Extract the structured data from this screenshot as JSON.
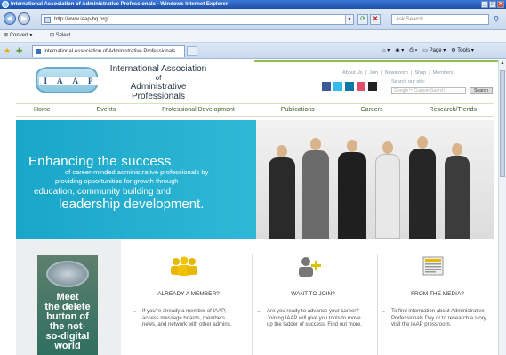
{
  "window": {
    "title": "International Association of Administrative Professionals - Windows Internet Explorer"
  },
  "address": {
    "url": "http://www.iaap-hq.org/",
    "search_placeholder": "Ask Search"
  },
  "command_bar": {
    "convert": "Convert",
    "select": "Select"
  },
  "tab": {
    "label": "International Association of Administrative Professionals"
  },
  "ie_tools": [
    "Page",
    "Tools"
  ],
  "header": {
    "logo_letters": [
      "I",
      "A",
      "A",
      "P"
    ],
    "org_line1": "International Association",
    "org_line2": "of",
    "org_line3": "Administrative Professionals",
    "top_links": [
      "About Us",
      "|",
      "Join",
      "|",
      "Newsroom",
      "|",
      "Shop",
      "|",
      "Members"
    ],
    "search_label": "Search our site:",
    "search_placeholder": "Google™ Custom Search",
    "search_button": "Search"
  },
  "nav": [
    "Home",
    "Events",
    "Professional Development",
    "Publications",
    "Careers",
    "Research/Trends"
  ],
  "hero": {
    "line1": "Enhancing the success",
    "line2": "of career-minded administrative professionals by",
    "line3": "providing opportunities for growth through",
    "line4": "education, community building and",
    "line5": "leadership development."
  },
  "promo": {
    "text_lines": [
      "Meet",
      "the delete",
      "button of",
      "the not-",
      "so-digital",
      "world"
    ]
  },
  "columns": [
    {
      "title": "ALREADY A MEMBER?",
      "text": "If you're already a member of IAAP, access message boards, members news, and network with other admins."
    },
    {
      "title": "WANT TO JOIN?",
      "text": "Are you ready to advance your career? Joining IAAP will give you tools to move up the ladder of success. Find out more."
    },
    {
      "title": "FROM THE MEDIA?",
      "text": "To find information about Administrative Professionals Day or to research a story, visit the IAAP pressroom."
    }
  ],
  "colors": {
    "teal": "#1aa6c9",
    "green": "#8bc34a",
    "nav_text": "#3c5f2a",
    "title_bar": "#1d4fa8"
  }
}
